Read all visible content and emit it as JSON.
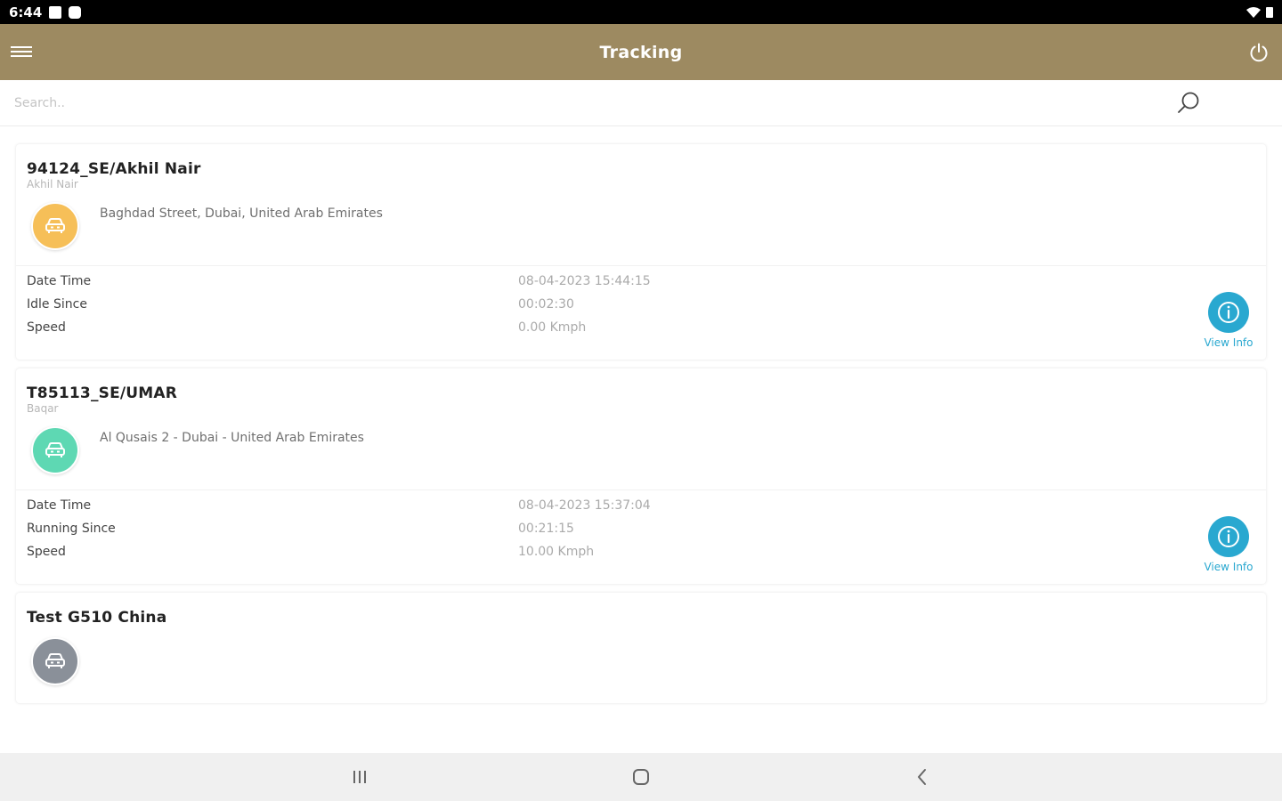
{
  "status_bar": {
    "time": "6:44"
  },
  "app_bar": {
    "title": "Tracking"
  },
  "search": {
    "placeholder": "Search.."
  },
  "vehicles": [
    {
      "name": "94124_SE/Akhil Nair",
      "driver": "Akhil Nair",
      "address": "Baghdad Street, Dubai, United Arab Emirates",
      "status_color": "#f6bf58",
      "rows": [
        {
          "label": "Date Time",
          "value": "08-04-2023 15:44:15"
        },
        {
          "label": "Idle Since",
          "value": "00:02:30"
        },
        {
          "label": "Speed",
          "value": "0.00 Kmph"
        }
      ],
      "view_info_label": "View Info"
    },
    {
      "name": "T85113_SE/UMAR",
      "driver": "Baqar",
      "address": "Al Qusais 2 - Dubai - United Arab Emirates",
      "status_color": "#5ed8b3",
      "rows": [
        {
          "label": "Date Time",
          "value": "08-04-2023 15:37:04"
        },
        {
          "label": "Running Since",
          "value": "00:21:15"
        },
        {
          "label": "Speed",
          "value": "10.00 Kmph"
        }
      ],
      "view_info_label": "View Info"
    },
    {
      "name": "Test G510 China",
      "status_color": "#8a9099"
    }
  ],
  "colors": {
    "app_bar": "#9d8a61",
    "accent": "#29a8d0"
  }
}
